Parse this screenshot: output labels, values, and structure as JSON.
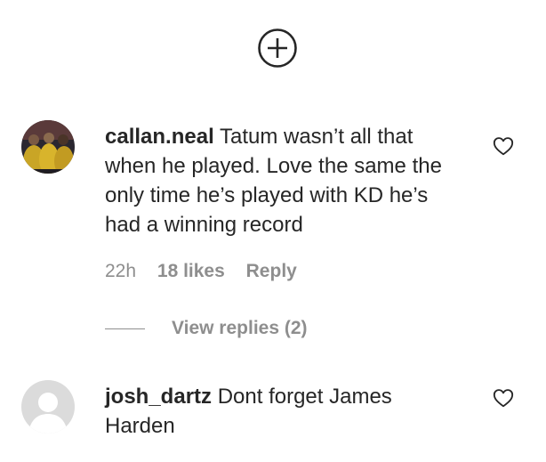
{
  "load_more": {
    "icon": "plus-circle-icon"
  },
  "comments": [
    {
      "username": "callan.neal",
      "text": " Tatum wasn’t all that when he played. Love the same the only time he’s played with KD he’s had a winning record",
      "time": "22h",
      "likes": "18 likes",
      "reply": "Reply",
      "view_replies": "View replies (2)",
      "avatar_icon": "team-photo-avatar"
    },
    {
      "username": "josh_dartz",
      "text": " Dont forget James Harden",
      "avatar_icon": "default-avatar-icon"
    }
  ],
  "colors": {
    "text": "#262626",
    "secondary": "#8e8e8e",
    "avatar_bg": "#dbdbdb",
    "background": "#ffffff"
  }
}
